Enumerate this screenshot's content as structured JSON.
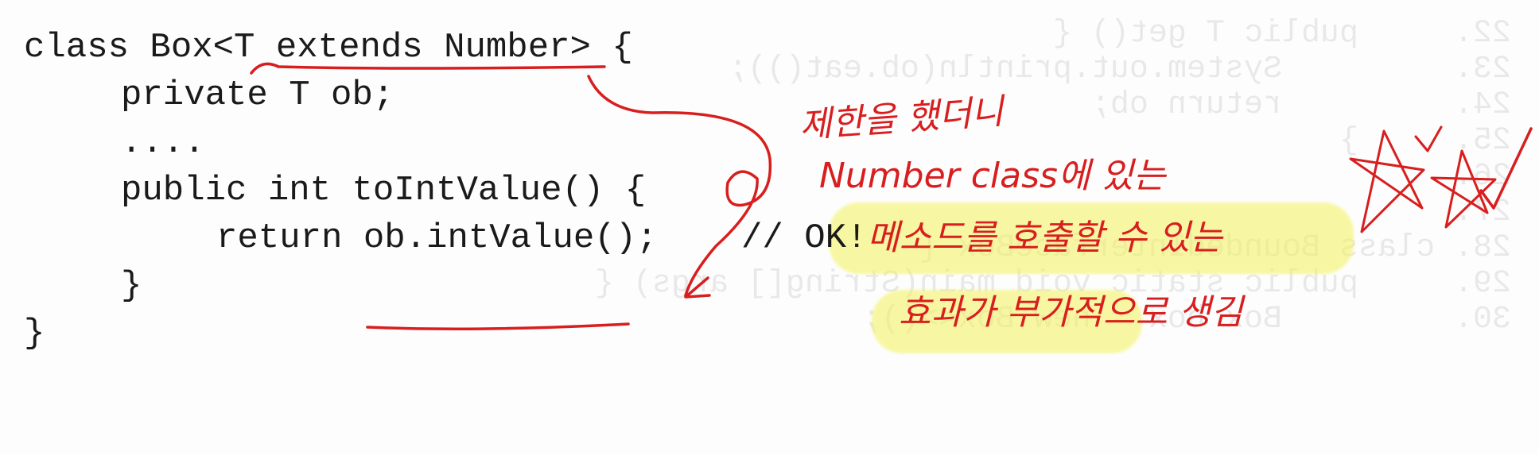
{
  "code": {
    "lines": [
      "class Box<T extends Number> {",
      "private T ob;",
      "....",
      "public int toIntValue() {",
      "return ob.intValue();",
      "}",
      "}"
    ],
    "comment": "// OK!"
  },
  "annotation": {
    "line1": "제한을 했더니",
    "line2": "Number class에 있는",
    "line3": "메소드를 호출할 수 있는",
    "line4": "효과가 부가적으로 생김"
  },
  "colors": {
    "ink": "#d81e1e",
    "highlighter": "#f3f25a",
    "code_text": "#1a1a1a"
  }
}
